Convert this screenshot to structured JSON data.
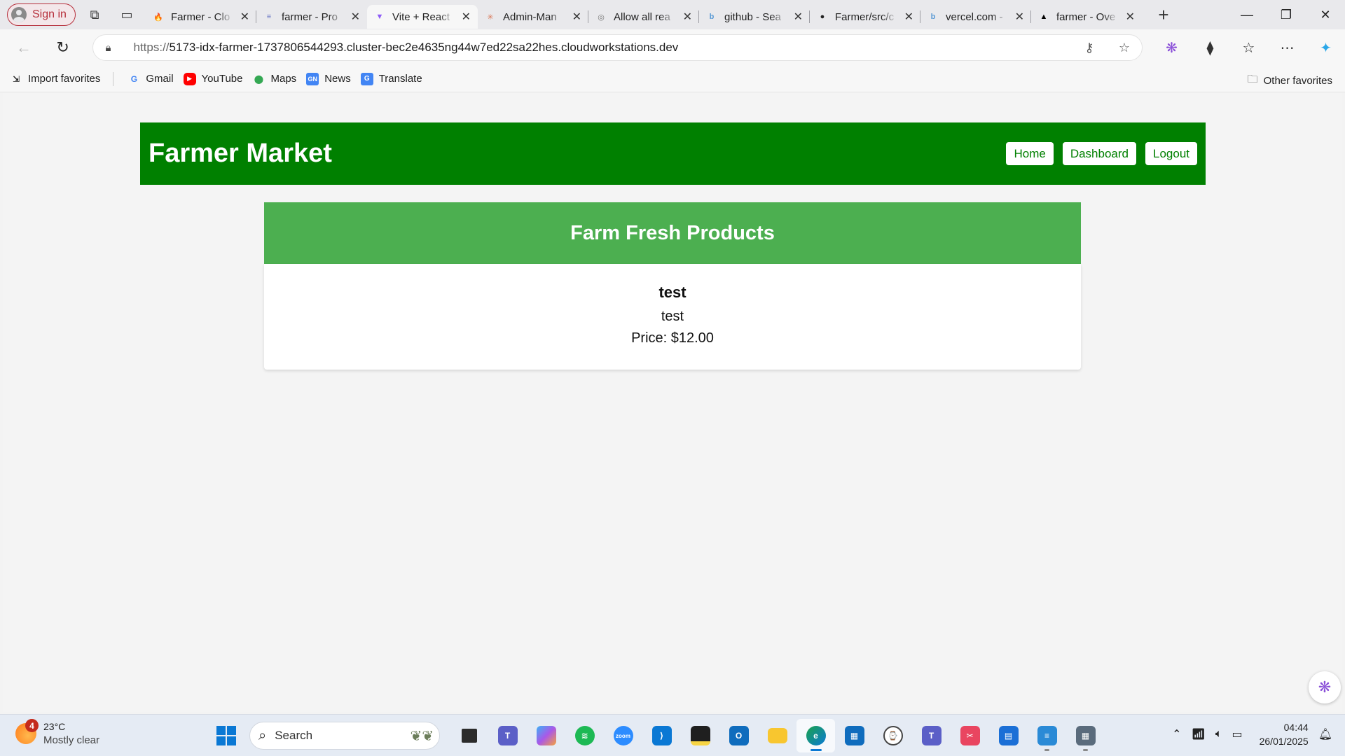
{
  "browser": {
    "signin_label": "Sign in",
    "tabs": [
      {
        "title": "Farmer - Clo",
        "icon": "firebase-icon",
        "color": "#ff8a00",
        "glyph": "🔥"
      },
      {
        "title": "farmer - Pro",
        "icon": "project-icon",
        "color": "#6f7cc6",
        "glyph": "≡"
      },
      {
        "title": "Vite + React",
        "icon": "vite-icon",
        "color": "#8e5cf7",
        "glyph": "▼",
        "active": true
      },
      {
        "title": "Admin-Man",
        "icon": "claude-icon",
        "color": "#d97757",
        "glyph": "✳"
      },
      {
        "title": "Allow all rea",
        "icon": "chatgpt-icon",
        "color": "#7a7a7a",
        "glyph": "◎"
      },
      {
        "title": "github - Sea",
        "icon": "bing-icon",
        "color": "#5b9bd5",
        "glyph": "b"
      },
      {
        "title": "Farmer/src/c",
        "icon": "github-icon",
        "color": "#222222",
        "glyph": "●"
      },
      {
        "title": "vercel.com -",
        "icon": "bing-icon",
        "color": "#5b9bd5",
        "glyph": "b"
      },
      {
        "title": "farmer - Ove",
        "icon": "vercel-icon",
        "color": "#000000",
        "glyph": "▲"
      }
    ],
    "url_scheme": "https://",
    "url_rest": "5173-idx-farmer-1737806544293.cluster-bec2e4635ng44w7ed22sa22hes.cloudworkstations.dev",
    "favorites": [
      {
        "label": "Import favorites",
        "icon": "import-icon"
      },
      {
        "label": "Gmail",
        "icon": "google-icon"
      },
      {
        "label": "YouTube",
        "icon": "youtube-icon"
      },
      {
        "label": "Maps",
        "icon": "maps-icon"
      },
      {
        "label": "News",
        "icon": "news-icon"
      },
      {
        "label": "Translate",
        "icon": "translate-icon"
      }
    ],
    "other_favorites": "Other favorites"
  },
  "site": {
    "title": "Farmer Market",
    "nav": {
      "home": "Home",
      "dashboard": "Dashboard",
      "logout": "Logout"
    },
    "section_title": "Farm Fresh Products",
    "product": {
      "name": "test",
      "description": "test",
      "price": "Price: $12.00"
    },
    "colors": {
      "header": "#008000",
      "banner": "#4caf50"
    }
  },
  "taskbar": {
    "weather_badge": "4",
    "temperature": "23°C",
    "condition": "Mostly clear",
    "search_placeholder": "Search",
    "time": "04:44",
    "date": "26/01/2025"
  }
}
